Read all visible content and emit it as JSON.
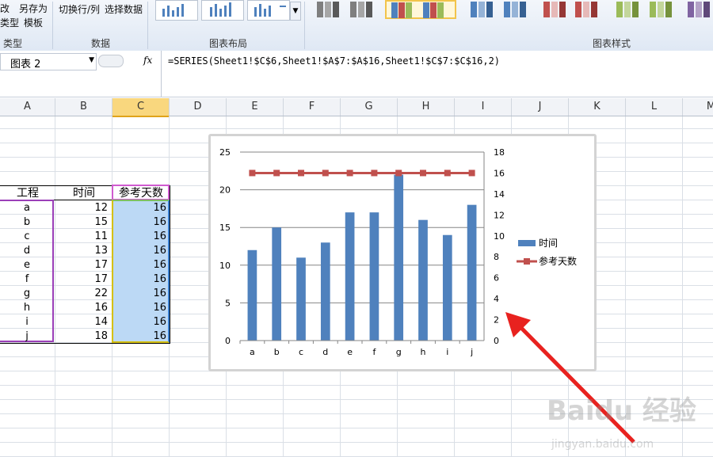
{
  "ribbon": {
    "type_group": {
      "btn_change_type_partial": "改",
      "btn_change_type_line2_partial": "类型",
      "btn_save_as": "另存为",
      "btn_template": "模板",
      "label": "类型"
    },
    "data_group": {
      "btn_switch": "切换行/列",
      "btn_select": "选择数据",
      "label": "数据"
    },
    "layout_group": {
      "label": "图表布局"
    },
    "style_group": {
      "label": "图表样式"
    }
  },
  "formula_bar": {
    "name_box": "图表 2",
    "fx": "fx",
    "formula": "=SERIES(Sheet1!$C$6,Sheet1!$A$7:$A$16,Sheet1!$C$7:$C$16,2)"
  },
  "columns": [
    "A",
    "B",
    "C",
    "D",
    "E",
    "F",
    "G",
    "H",
    "I",
    "J",
    "K",
    "L",
    "M"
  ],
  "table": {
    "headers": [
      "工程",
      "时间",
      "参考天数"
    ],
    "rows": [
      [
        "a",
        "12",
        "16"
      ],
      [
        "b",
        "15",
        "16"
      ],
      [
        "c",
        "11",
        "16"
      ],
      [
        "d",
        "13",
        "16"
      ],
      [
        "e",
        "17",
        "16"
      ],
      [
        "f",
        "17",
        "16"
      ],
      [
        "g",
        "22",
        "16"
      ],
      [
        "h",
        "16",
        "16"
      ],
      [
        "i",
        "14",
        "16"
      ],
      [
        "j",
        "18",
        "16"
      ]
    ]
  },
  "chart_data": {
    "type": "bar",
    "categories": [
      "a",
      "b",
      "c",
      "d",
      "e",
      "f",
      "g",
      "h",
      "i",
      "j"
    ],
    "series": [
      {
        "name": "时间",
        "type": "bar",
        "axis": "primary",
        "color": "#4f81bd",
        "values": [
          12,
          15,
          11,
          13,
          17,
          17,
          22,
          16,
          14,
          18
        ]
      },
      {
        "name": "参考天数",
        "type": "line",
        "axis": "secondary",
        "color": "#c0504d",
        "values": [
          16,
          16,
          16,
          16,
          16,
          16,
          16,
          16,
          16,
          16
        ]
      }
    ],
    "ylim": [
      0,
      25
    ],
    "yticks": [
      0,
      5,
      10,
      15,
      20,
      25
    ],
    "y2lim": [
      0,
      18
    ],
    "y2ticks": [
      0,
      2,
      4,
      6,
      8,
      10,
      12,
      14,
      16,
      18
    ],
    "grid": true,
    "legend_position": "right"
  },
  "annotation": {
    "arrow_color": "#e8221f"
  },
  "watermark": {
    "text": "Baidu 经验",
    "subtext": "jingyan.baidu.com"
  }
}
